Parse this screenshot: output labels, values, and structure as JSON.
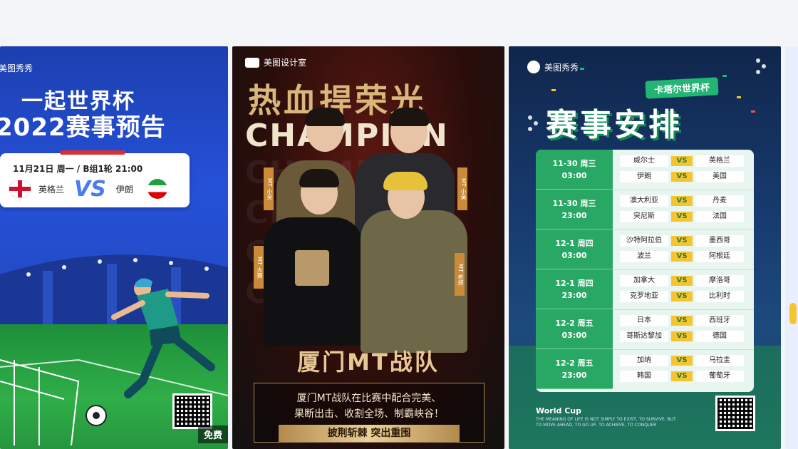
{
  "cards": [
    {
      "brand": "美图秀秀",
      "title_line1": "一起世界杯",
      "title_line2": "2022赛事预告",
      "match_date": "11月21日 周一 /  B组1轮 21:00",
      "team_home": "英格兰",
      "vs": "VS",
      "team_away": "伊朗",
      "badge": "免费"
    },
    {
      "brand": "美图设计室",
      "title": "热血捍荣光",
      "champion": "CHAMPION",
      "team_name": "厦门MT战队",
      "desc_line1": "厦门MT战队在比赛中配合完美、",
      "desc_line2": "果断出击、收割全场、制霸峡谷！",
      "slogan": "披荆斩棘  突出重围",
      "tags": [
        "MT 小吴",
        "MT 小黄",
        "MT 大赛",
        "MT 老郑"
      ]
    },
    {
      "brand": "美图秀秀",
      "subtitle": "卡塔尔世界杯",
      "title": "赛事安排",
      "footer_title": "World Cup",
      "footer_text": "THE MEANING OF LIFE IS NOT SIMPLY TO EXIST, TO SURVIVE, BUT TO MOVE AHEAD, TO GO UP, TO ACHIEVE, TO CONQUER",
      "schedule": [
        {
          "date": "11-30 周三",
          "time": "03:00",
          "m1": [
            "威尔士",
            "英格兰"
          ],
          "m2": [
            "伊朗",
            "美国"
          ]
        },
        {
          "date": "11-30 周三",
          "time": "23:00",
          "m1": [
            "澳大利亚",
            "丹麦"
          ],
          "m2": [
            "突尼斯",
            "法国"
          ]
        },
        {
          "date": "12-1 周四",
          "time": "03:00",
          "m1": [
            "沙特阿拉伯",
            "墨西哥"
          ],
          "m2": [
            "波兰",
            "阿根廷"
          ]
        },
        {
          "date": "12-1 周四",
          "time": "23:00",
          "m1": [
            "加拿大",
            "摩洛哥"
          ],
          "m2": [
            "克罗地亚",
            "比利时"
          ]
        },
        {
          "date": "12-2 周五",
          "time": "03:00",
          "m1": [
            "日本",
            "西班牙"
          ],
          "m2": [
            "哥斯达黎加",
            "德国"
          ]
        },
        {
          "date": "12-2 周五",
          "time": "23:00",
          "m1": [
            "加纳",
            "乌拉圭"
          ],
          "m2": [
            "韩国",
            "葡萄牙"
          ]
        }
      ],
      "vs": "VS"
    }
  ]
}
